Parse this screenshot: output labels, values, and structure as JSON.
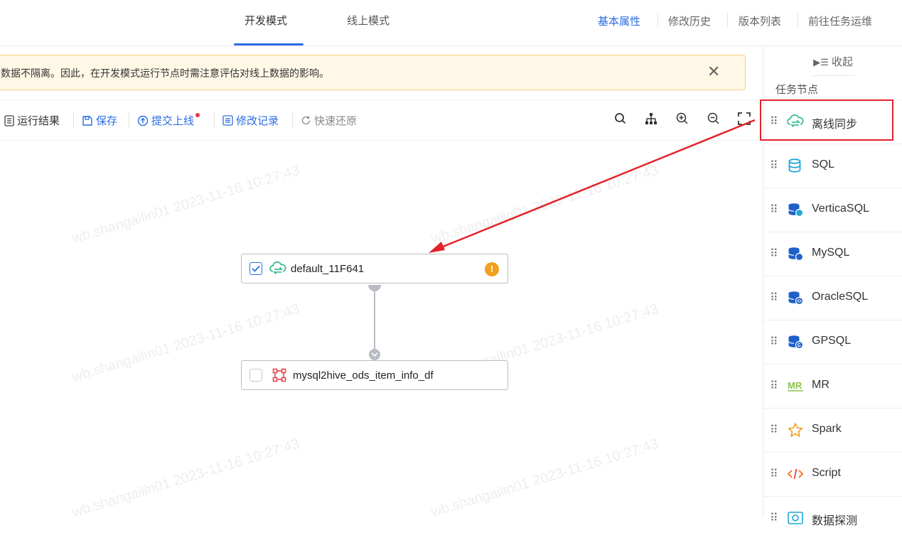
{
  "header": {
    "mode_tabs": [
      "开发模式",
      "线上模式"
    ],
    "links": [
      "基本属性",
      "修改历史",
      "版本列表",
      "前往任务运维"
    ]
  },
  "banner": {
    "text": "数据不隔离。因此，在开发模式运行节点时需注意评估对线上数据的影响。",
    "close": "✕"
  },
  "toolbar": {
    "run_result": "运行结果",
    "save": "保存",
    "submit": "提交上线",
    "history": "修改记录",
    "restore": "快速还原"
  },
  "canvas": {
    "nodes": [
      {
        "label": "default_11F641",
        "checked": true,
        "warning": "!"
      },
      {
        "label": "mysql2hive_ods_item_info_df",
        "checked": false
      }
    ],
    "watermark": "wb.shangailin01 2023-11-16 10:27:43"
  },
  "panel": {
    "collapse": "收起",
    "title": "任务节点",
    "items": [
      {
        "label": "离线同步",
        "icon": "sync-cloud-icon"
      },
      {
        "label": "SQL",
        "icon": "database-icon"
      },
      {
        "label": "VerticaSQL",
        "icon": "vertica-db-icon"
      },
      {
        "label": "MySQL",
        "icon": "mysql-db-icon"
      },
      {
        "label": "OracleSQL",
        "icon": "oracle-db-icon"
      },
      {
        "label": "GPSQL",
        "icon": "gp-db-icon"
      },
      {
        "label": "MR",
        "icon": "mr-icon"
      },
      {
        "label": "Spark",
        "icon": "star-icon"
      },
      {
        "label": "Script",
        "icon": "code-icon"
      },
      {
        "label": "数据探测",
        "icon": "probe-icon"
      }
    ]
  },
  "colors": {
    "accent": "#2a6ce6",
    "warning": "#f0a020",
    "annotation": "#e2232a",
    "sync": "#2bb585"
  }
}
